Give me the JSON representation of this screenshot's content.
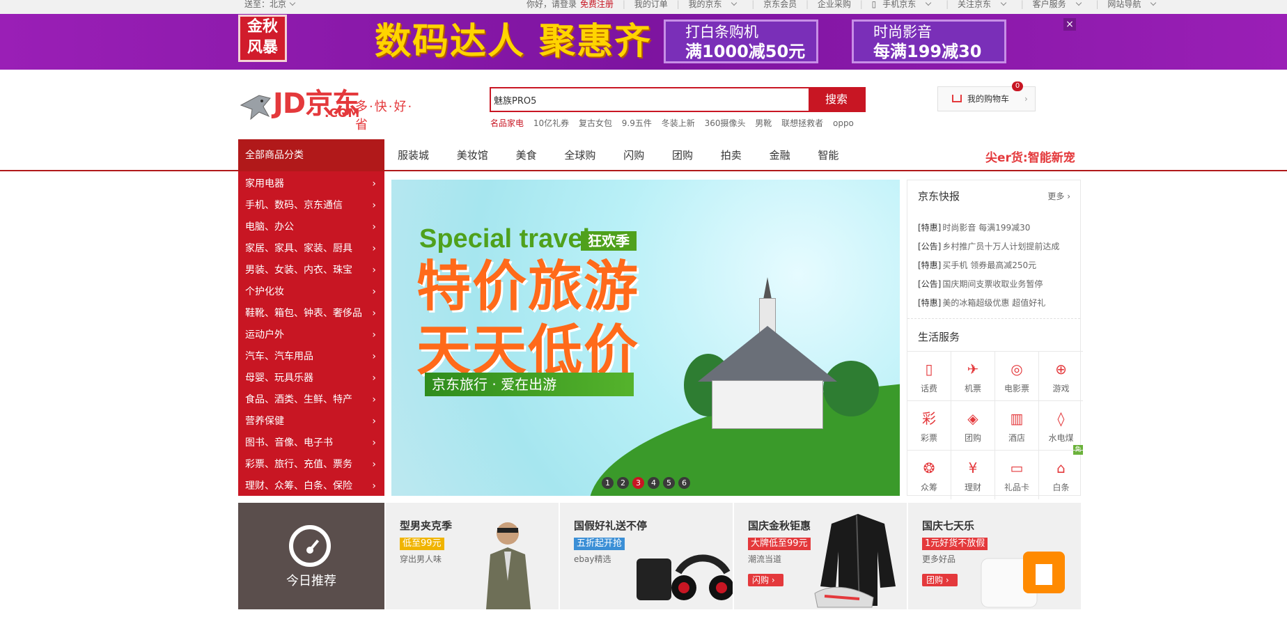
{
  "topbar": {
    "location": "送至：北京",
    "greeting": "你好，请登录",
    "register": "免费注册",
    "links": [
      "我的订单",
      "我的京东",
      "京东会员",
      "企业采购",
      "手机京东",
      "关注京东",
      "客户服务",
      "网站导航"
    ]
  },
  "promo": {
    "badge": "金秋风暴",
    "slogan": "数码达人 聚惠齐",
    "box1_line1": "打白条购机",
    "box1_line2": "满1000减50元",
    "box2_line1": "时尚影音",
    "box2_line2": "每满199减30",
    "close": "×"
  },
  "header": {
    "logo_text": "JD京东",
    "logo_com": ".COM",
    "slogan": "多·快·好·省",
    "search_value": "魅族PRO5",
    "search_button": "搜索",
    "hot_words": [
      "名品家电",
      "10亿礼券",
      "复古女包",
      "9.9五件",
      "冬装上新",
      "360摄像头",
      "男靴",
      "联想拯救者",
      "oppo"
    ],
    "cart_label": "我的购物车",
    "cart_count": "0",
    "cart_arrow": "›"
  },
  "nav": {
    "all_categories": "全部商品分类",
    "items": [
      "服装城",
      "美妆馆",
      "美食",
      "全球购",
      "闪购",
      "团购",
      "拍卖",
      "金融",
      "智能"
    ],
    "right_promo": "尖er货:智能新宠"
  },
  "categories": [
    "家用电器",
    "手机、数码、京东通信",
    "电脑、办公",
    "家居、家具、家装、厨具",
    "男装、女装、内衣、珠宝",
    "个护化妆",
    "鞋靴、箱包、钟表、奢侈品",
    "运动户外",
    "汽车、汽车用品",
    "母婴、玩具乐器",
    "食品、酒类、生鲜、特产",
    "营养保健",
    "图书、音像、电子书",
    "彩票、旅行、充值、票务",
    "理财、众筹、白条、保险"
  ],
  "slider": {
    "en_title": "Special travel",
    "en_tag": "狂欢季",
    "line1": "特价旅游",
    "line2": "天天低价",
    "ribbon": "京东旅行 · 爱在出游",
    "dots": [
      "1",
      "2",
      "3",
      "4",
      "5",
      "6"
    ],
    "active_dot": 3
  },
  "news": {
    "title": "京东快报",
    "more": "更多 ›",
    "items": [
      {
        "tag": "[特惠]",
        "text": "时尚影音 每满199减30"
      },
      {
        "tag": "[公告]",
        "text": "乡村推广员十万人计划提前达成"
      },
      {
        "tag": "[特惠]",
        "text": "买手机 领券最高减250元"
      },
      {
        "tag": "[公告]",
        "text": "国庆期间支票收取业务暂停"
      },
      {
        "tag": "[特惠]",
        "text": "美的冰箱超级优惠 超值好礼"
      }
    ],
    "life_title": "生活服务",
    "services": [
      {
        "label": "话费",
        "icon": "phone-icon",
        "glyph": "▯"
      },
      {
        "label": "机票",
        "icon": "plane-icon",
        "glyph": "✈"
      },
      {
        "label": "电影票",
        "icon": "film-icon",
        "glyph": "◎"
      },
      {
        "label": "游戏",
        "icon": "gamepad-icon",
        "glyph": "⊕"
      },
      {
        "label": "彩票",
        "icon": "lottery-icon",
        "glyph": "彩"
      },
      {
        "label": "团购",
        "icon": "tag-icon",
        "glyph": "◈"
      },
      {
        "label": "酒店",
        "icon": "hotel-icon",
        "glyph": "▥"
      },
      {
        "label": "水电煤",
        "icon": "drop-icon",
        "glyph": "◊"
      },
      {
        "label": "众筹",
        "icon": "hand-coin-icon",
        "glyph": "❂"
      },
      {
        "label": "理财",
        "icon": "yen-icon",
        "glyph": "¥"
      },
      {
        "label": "礼品卡",
        "icon": "card-icon",
        "glyph": "▭"
      },
      {
        "label": "白条",
        "icon": "note-icon",
        "glyph": "⌂"
      }
    ],
    "free_badge": "免"
  },
  "recommend": {
    "today": "今日推荐",
    "cards": [
      {
        "title": "型男夹克季",
        "tag": "低至99元",
        "tag_color": "#f0b400",
        "sub": "穿出男人味",
        "button": ""
      },
      {
        "title": "国假好礼送不停",
        "tag": "五折起开抢",
        "tag_color": "#3b8fd6",
        "sub": "ebay精选",
        "button": ""
      },
      {
        "title": "国庆金秋钜惠",
        "tag": "大牌低至99元",
        "tag_color": "#e4393c",
        "sub": "潮流当道",
        "button": "闪购 ›"
      },
      {
        "title": "国庆七天乐",
        "tag": "1元好货不放假",
        "tag_color": "#e4393c",
        "sub": "更多好品",
        "button": "团购 ›"
      }
    ]
  },
  "colors": {
    "brand_red": "#c81623",
    "nav_red": "#b1191a",
    "promo_purple": "#8a1aad"
  }
}
